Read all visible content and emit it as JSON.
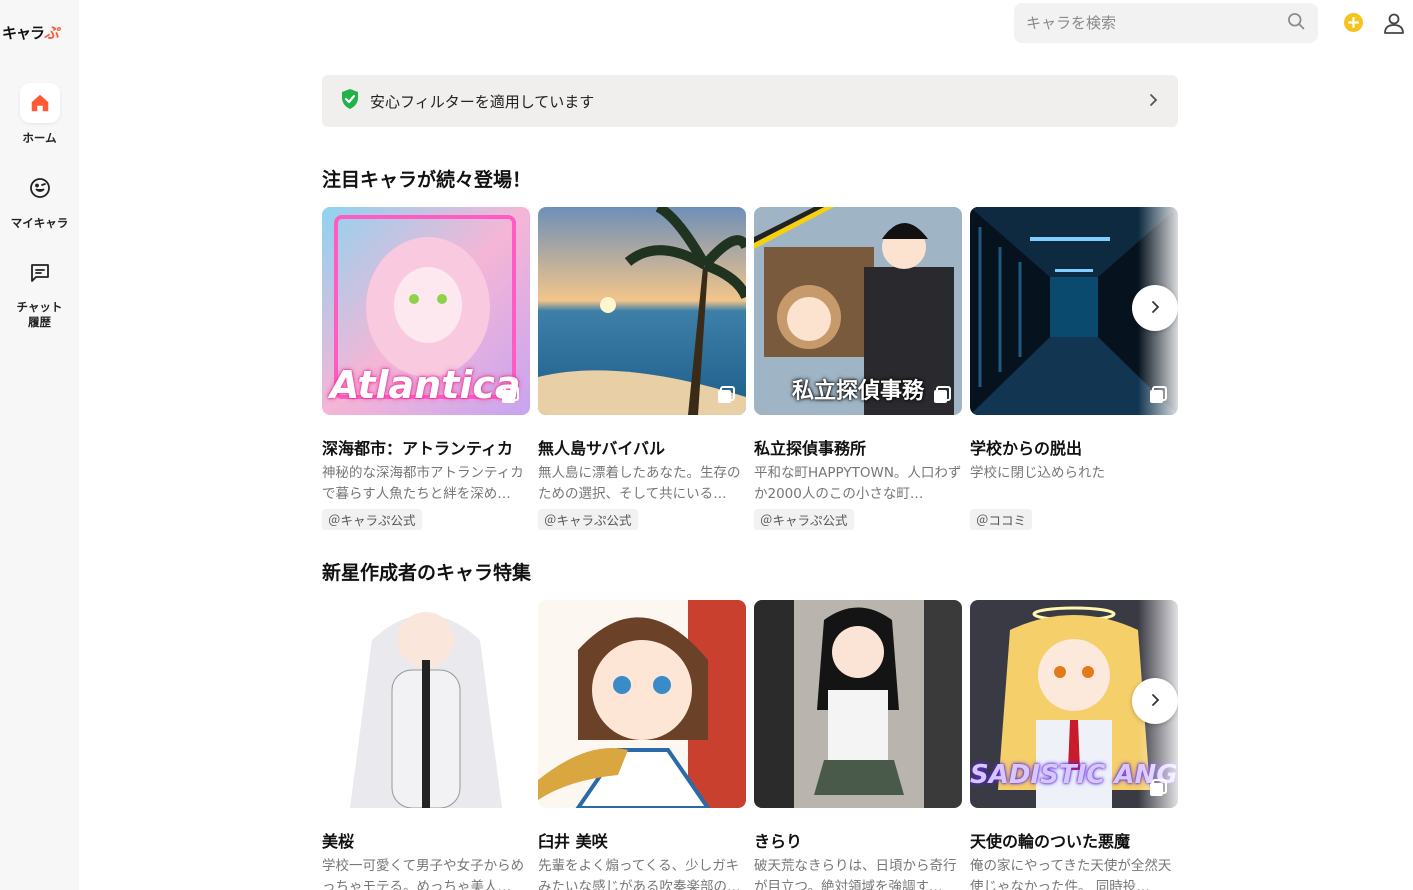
{
  "sidebar": {
    "logo_main": "キャラ",
    "logo_accent": "ぷ",
    "items": [
      {
        "label": "ホーム",
        "icon": "home-icon"
      },
      {
        "label": "マイキャラ",
        "icon": "smile-face-icon"
      },
      {
        "label": "チャット\n履歴",
        "icon": "chat-bubble-icon"
      }
    ]
  },
  "header": {
    "search_placeholder": "キャラを検索",
    "search_icon": "search-icon",
    "coin_icon": "coin-icon",
    "user_icon": "user-icon"
  },
  "filter": {
    "text": "安心フィルターを適用しています",
    "icon": "shield-check-icon",
    "accent": "#22b14c"
  },
  "sections": [
    {
      "title": "注目キャラが続々登場！",
      "cards": [
        {
          "title": "深海都市：アトランティカ",
          "desc": "神秘的な深海都市アトランティカで暮らす人魚たちと絆を深め…",
          "author": "＠キャラぷ公式",
          "thumb_text": "Atlantica"
        },
        {
          "title": "無人島サバイバル",
          "desc": "無人島に漂着したあなた。生存のための選択、そして共にいる…",
          "author": "＠キャラぷ公式",
          "thumb_text": ""
        },
        {
          "title": "私立探偵事務所",
          "desc": "平和な町HAPPYTOWN。人口わずか2000人のこの小さな町…",
          "author": "＠キャラぷ公式",
          "thumb_text": "私立探偵事務"
        },
        {
          "title": "学校からの脱出",
          "desc": "学校に閉じ込められた",
          "author": "＠ココミ",
          "thumb_text": ""
        }
      ]
    },
    {
      "title": "新星作成者のキャラ特集",
      "cards": [
        {
          "title": "美桜",
          "desc": "学校一可愛くて男子や女子からめっちゃモテる。めっちゃ美人…",
          "author": "",
          "thumb_text": ""
        },
        {
          "title": "臼井 美咲",
          "desc": "先輩をよく煽ってくる、少しガキみたいな感じがある吹奏楽部の…",
          "author": "",
          "thumb_text": ""
        },
        {
          "title": "きらり",
          "desc": "破天荒なきらりは、日頃から奇行が目立つ。絶対領域を強調す…",
          "author": "",
          "thumb_text": ""
        },
        {
          "title": "天使の輪のついた悪魔",
          "desc": "俺の家にやってきた天使が全然天使じゃなかった件。 同時投…",
          "author": "",
          "thumb_text": "SADISTIC ANGEL"
        }
      ]
    }
  ]
}
